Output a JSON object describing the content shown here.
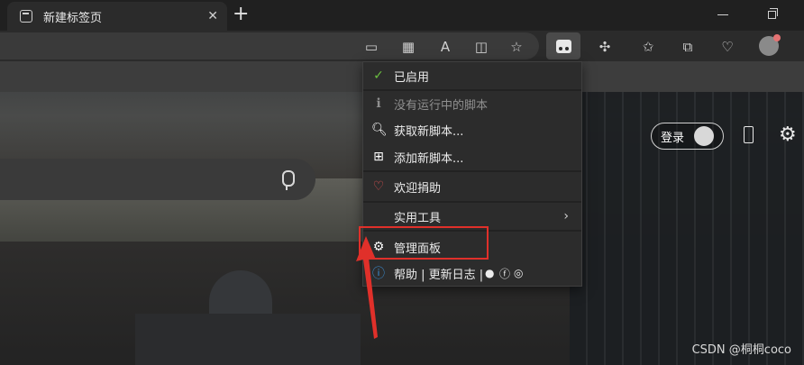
{
  "tab": {
    "title": "新建标签页",
    "close_glyph": "✕"
  },
  "newtab_glyph": "+",
  "menu": {
    "enabled": "已启用",
    "no_scripts": "没有运行中的脚本",
    "get_scripts": "获取新脚本...",
    "add_script": "添加新脚本...",
    "donate": "欢迎捐助",
    "tools": "实用工具",
    "dashboard": "管理面板",
    "help_links": "帮助 | 更新日志 |"
  },
  "page": {
    "login_label": "登录"
  },
  "watermark": "CSDN @桐桐coco",
  "colors": {
    "check": "#6abf40",
    "heart": "#e05252",
    "info": "#3b8fd6",
    "highlight": "#e0302a"
  }
}
